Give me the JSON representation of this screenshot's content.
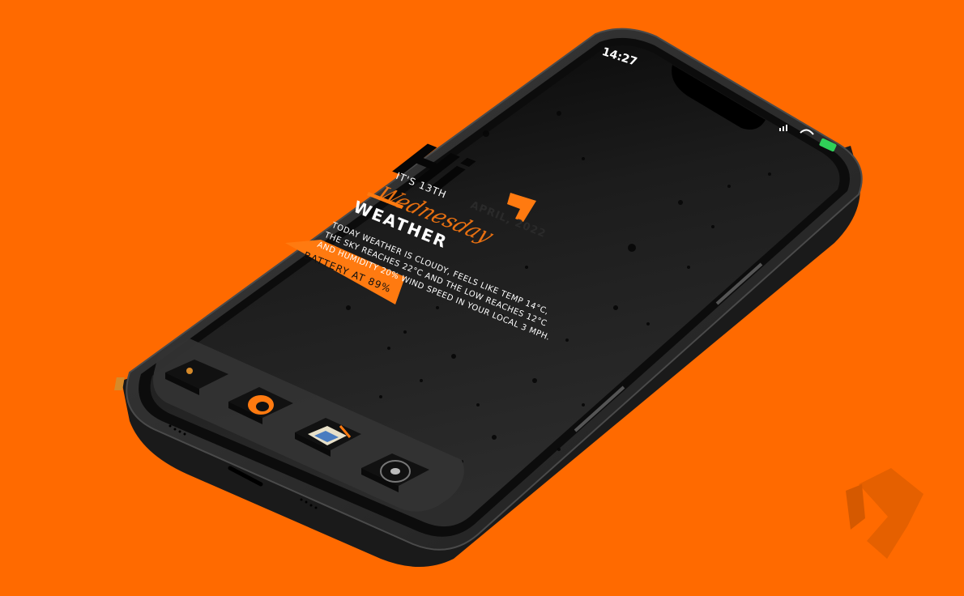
{
  "status_bar": {
    "time": "14:27",
    "signal_icon": "signal-bars-icon",
    "wifi_icon": "wifi-icon",
    "battery_icon": "battery-charging-icon"
  },
  "widget": {
    "greeting": "Hi",
    "date_prefix": "IT'S 13TH",
    "weekday_script": "Wednesday",
    "date": "APRIL, 2022",
    "weather_title": "WEATHER",
    "weather_line1": "TODAY WEATHER IS CLOUDY, FEELS LIKE TEMP 14°C,",
    "weather_line2": "THE SKY REACHES 22°C AND THE LOW REACHES 12°C",
    "weather_line3": "AND HUMIDITY 20% WIND SPEED IN YOUR LOCAL 3 MPH.",
    "battery_label": "BATTERY AT 89%"
  },
  "dock": {
    "apps": [
      {
        "name": "info-app-icon"
      },
      {
        "name": "firefox-app-icon"
      },
      {
        "name": "notes-app-icon"
      },
      {
        "name": "camera-app-icon"
      }
    ]
  },
  "colors": {
    "background": "#ff6a00",
    "accent": "#ff7a10",
    "screen": "#1a1a1a",
    "frame": "#2b2b2b"
  }
}
